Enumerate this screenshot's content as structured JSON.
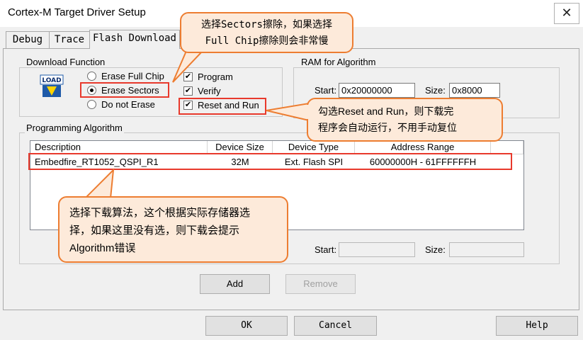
{
  "window": {
    "title": "Cortex-M Target Driver Setup",
    "close_glyph": "✕"
  },
  "tabs": [
    {
      "label": "Debug"
    },
    {
      "label": "Trace"
    },
    {
      "label": "Flash Download"
    }
  ],
  "download_function": {
    "group_label": "Download Function",
    "icon_text": "LOAD",
    "radios": [
      {
        "label": "Erase Full Chip",
        "selected": false
      },
      {
        "label": "Erase Sectors",
        "selected": true
      },
      {
        "label": "Do not Erase",
        "selected": false
      }
    ],
    "checkboxes": [
      {
        "label": "Program",
        "checked": true
      },
      {
        "label": "Verify",
        "checked": true
      },
      {
        "label": "Reset and Run",
        "checked": true
      }
    ]
  },
  "ram": {
    "group_label": "RAM for Algorithm",
    "start_label": "Start:",
    "start_value": "0x20000000",
    "size_label": "Size:",
    "size_value": "0x8000"
  },
  "algorithm": {
    "group_label": "Programming Algorithm",
    "columns": [
      "Description",
      "Device Size",
      "Device Type",
      "Address Range"
    ],
    "rows": [
      {
        "description": "Embedfire_RT1052_QSPI_R1",
        "device_size": "32M",
        "device_type": "Ext. Flash SPI",
        "address_range": "60000000H - 61FFFFFFH"
      }
    ],
    "start_label": "Start:",
    "start_value": "",
    "size_label": "Size:",
    "size_value": ""
  },
  "buttons": {
    "add": "Add",
    "remove": "Remove",
    "ok": "OK",
    "cancel": "Cancel",
    "help": "Help"
  },
  "callouts": {
    "sectors": [
      "选择Sectors擦除，如果选择",
      "Full Chip擦除则会非常慢"
    ],
    "reset": [
      "勾选Reset  and Run，则下载完",
      "程序会自动运行，不用手动复位"
    ],
    "algorithm": [
      "选择下载算法，这个根据实际存储器选",
      "择，如果这里没有选，则下载会提示",
      "Algorithm错误"
    ]
  },
  "colors": {
    "highlight": "#e8392c",
    "callout_border": "#ed7d31",
    "callout_fill": "#fdeada"
  },
  "icons": {
    "close": "close-icon",
    "load": "load-icon"
  }
}
